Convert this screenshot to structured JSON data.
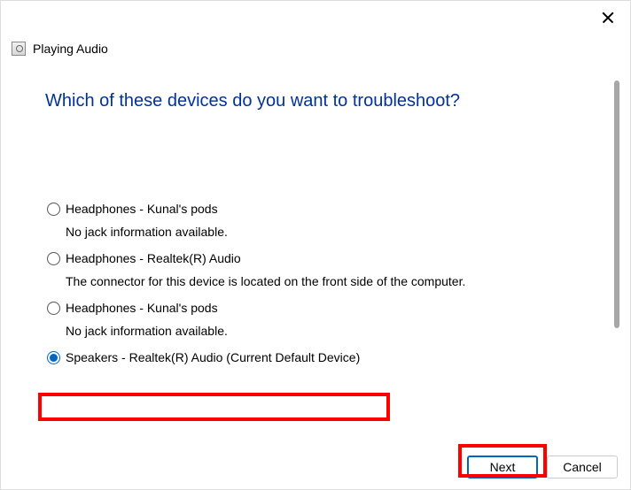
{
  "window": {
    "title": "Playing Audio"
  },
  "main": {
    "heading": "Which of these devices do you want to troubleshoot?",
    "options": [
      {
        "label": "Headphones - Kunal's pods",
        "desc": "No jack information available.",
        "selected": false
      },
      {
        "label": "Headphones - Realtek(R) Audio",
        "desc": "The connector for this device is located on the front side of the computer.",
        "selected": false
      },
      {
        "label": "Headphones - Kunal's pods",
        "desc": "No jack information available.",
        "selected": false
      },
      {
        "label": "Speakers - Realtek(R) Audio (Current Default Device)",
        "desc": "",
        "selected": true
      }
    ]
  },
  "footer": {
    "next": "Next",
    "cancel": "Cancel"
  }
}
